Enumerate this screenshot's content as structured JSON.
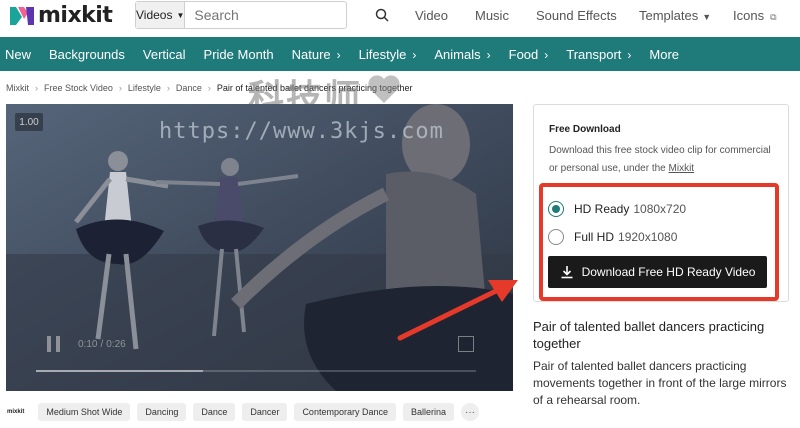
{
  "header": {
    "logo_text": "mixkit",
    "search": {
      "type_label": "Videos",
      "placeholder": "Search"
    },
    "nav": [
      {
        "label": "Video"
      },
      {
        "label": "Music"
      },
      {
        "label": "Sound Effects"
      },
      {
        "label": "Templates"
      },
      {
        "label": "Icons"
      }
    ]
  },
  "categories": [
    "New",
    "Backgrounds",
    "Vertical",
    "Pride Month",
    "Nature",
    "Lifestyle",
    "Animals",
    "Food",
    "Transport",
    "More"
  ],
  "breadcrumb": [
    "Mixkit",
    "Free Stock Video",
    "Lifestyle",
    "Dance",
    "Pair of talented ballet dancers practicing together"
  ],
  "watermark": {
    "cn": "科技师",
    "url": "https://www.3kjs.com"
  },
  "player": {
    "timer": "1.00",
    "time_current": "0:10",
    "time_total": "0:26",
    "progress": 0.38
  },
  "tags": {
    "logo": "mixkit",
    "items": [
      "Medium Shot Wide",
      "Dancing",
      "Dance",
      "Dancer",
      "Contemporary Dance",
      "Ballerina"
    ],
    "more": "···"
  },
  "download": {
    "title": "Free Download",
    "description": "Download this free stock video clip for commercial or personal use, under the",
    "license_link": "Mixkit",
    "options": [
      {
        "label": "HD Ready",
        "resolution": "1080x720",
        "selected": true
      },
      {
        "label": "Full HD",
        "resolution": "1920x1080",
        "selected": false
      }
    ],
    "button_label": "Download Free HD Ready Video"
  },
  "video_title": "Pair of talented ballet dancers practicing together",
  "video_description": "Pair of talented ballet dancers practicing movements together in front of the large mirrors of a rehearsal room.",
  "colors": {
    "brand_teal": "#1f7a7a",
    "highlight_red": "#e53a2a",
    "button_dark": "#1a1a1a"
  },
  "icons": [
    "search-icon",
    "external-link-icon",
    "chevron-right-icon",
    "download-icon",
    "play-pause-icon",
    "fullscreen-icon"
  ]
}
